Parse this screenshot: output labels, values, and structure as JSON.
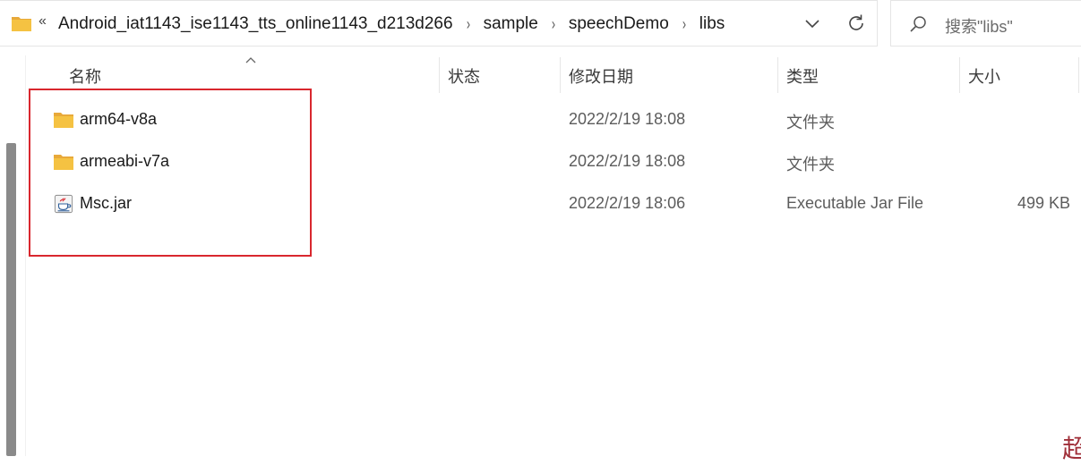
{
  "address_bar": {
    "overflow_label": "«",
    "crumbs": [
      "Android_iat1143_ise1143_tts_online1143_d213d266",
      "sample",
      "speechDemo",
      "libs"
    ],
    "separator": "›"
  },
  "search": {
    "placeholder": "搜索\"libs\""
  },
  "columns": {
    "name": "名称",
    "status": "状态",
    "date_modified": "修改日期",
    "type": "类型",
    "size": "大小"
  },
  "files": [
    {
      "name": "arm64-v8a",
      "date": "2022/2/19 18:08",
      "type": "文件夹",
      "size": "",
      "icon": "folder-icon"
    },
    {
      "name": "armeabi-v7a",
      "date": "2022/2/19 18:08",
      "type": "文件夹",
      "size": "",
      "icon": "folder-icon"
    },
    {
      "name": "Msc.jar",
      "date": "2022/2/19 18:06",
      "type": "Executable Jar File",
      "size": "499 KB",
      "icon": "java-jar-icon"
    }
  ],
  "watermark": {
    "glyph": "超"
  },
  "colors": {
    "highlight": "#d9272e",
    "folder": "#f5c242"
  }
}
